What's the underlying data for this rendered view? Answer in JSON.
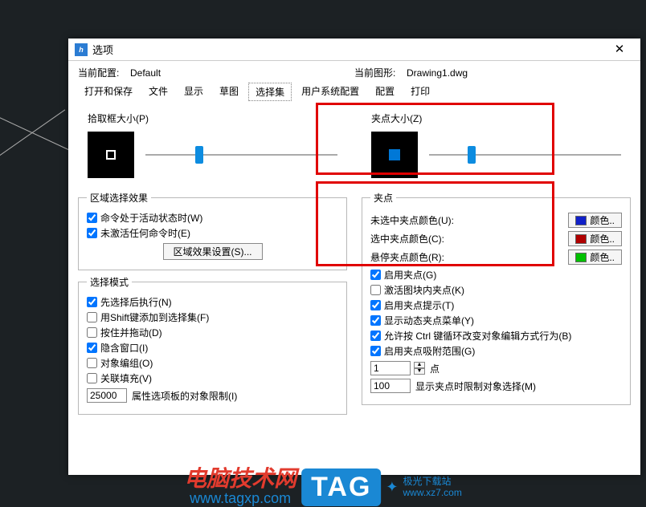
{
  "window": {
    "title": "选项"
  },
  "profile": {
    "current_profile_label": "当前配置:",
    "current_profile_value": "Default",
    "current_drawing_label": "当前图形:",
    "current_drawing_value": "Drawing1.dwg"
  },
  "tabs": {
    "open_save": "打开和保存",
    "files": "文件",
    "display": "显示",
    "draft": "草图",
    "selection": "选择集",
    "user_sys": "用户系统配置",
    "config": "配置",
    "print": "打印"
  },
  "left": {
    "pickbox_label": "拾取框大小(P)",
    "region_select_legend": "区域选择效果",
    "chk_active_cmd": "命令处于活动状态时(W)",
    "chk_no_active_cmd": "未激活任何命令时(E)",
    "region_effect_btn": "区域效果设置(S)...",
    "select_mode_legend": "选择模式",
    "chk_noun_verb": "先选择后执行(N)",
    "chk_shift_add": "用Shift键添加到选择集(F)",
    "chk_press_drag": "按住并拖动(D)",
    "chk_implied_window": "隐含窗口(I)",
    "chk_obj_group": "对象编组(O)",
    "chk_assoc_fill": "关联填充(V)",
    "obj_limit_value": "25000",
    "obj_limit_label": "属性选项板的对象限制(I)"
  },
  "right": {
    "grip_size_label": "夹点大小(Z)",
    "grip_legend": "夹点",
    "color_unselected_label": "未选中夹点颜色(U):",
    "color_selected_label": "选中夹点颜色(C):",
    "color_hover_label": "悬停夹点颜色(R):",
    "color_btn": "颜色..",
    "chk_enable_grips": "启用夹点(G)",
    "chk_block_grips": "激活图块内夹点(K)",
    "chk_grip_tips": "启用夹点提示(T)",
    "chk_dyn_grip_menu": "显示动态夹点菜单(Y)",
    "chk_ctrl_cycle": "允许按 Ctrl 键循环改变对象编辑方式行为(B)",
    "chk_grip_snap": "启用夹点吸附范围(G)",
    "points_value": "1",
    "points_label": "点",
    "grip_limit_value": "100",
    "grip_limit_label": "显示夹点时限制对象选择(M)",
    "colors": {
      "unselected": "#1020c8",
      "selected": "#b00000",
      "hover": "#00c000"
    }
  },
  "watermark": {
    "line1": "电脑技术网",
    "line2": "www.tagxp.com",
    "tag": "TAG",
    "side1": "极光下载站",
    "side2": "www.xz7.com"
  }
}
